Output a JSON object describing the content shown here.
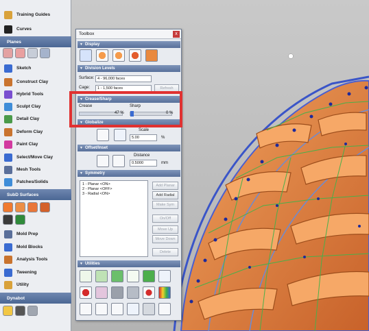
{
  "sidebar": {
    "items": [
      {
        "label": "Training Guides",
        "icon": "training-guides-icon",
        "color": "#d9a23b"
      },
      {
        "label": "Curves",
        "icon": "curves-icon",
        "color": "#222222"
      },
      {
        "label": "Sketch",
        "icon": "sketch-icon",
        "color": "#3a6bd1"
      },
      {
        "label": "Construct Clay",
        "icon": "construct-clay-icon",
        "color": "#c9742f"
      },
      {
        "label": "Hybrid Tools",
        "icon": "hybrid-tools-icon",
        "color": "#7a4fd0"
      },
      {
        "label": "Sculpt Clay",
        "icon": "sculpt-clay-icon",
        "color": "#3f8dd8"
      },
      {
        "label": "Detail Clay",
        "icon": "detail-clay-icon",
        "color": "#4a9a4a"
      },
      {
        "label": "Deform Clay",
        "icon": "deform-clay-icon",
        "color": "#c9742f"
      },
      {
        "label": "Paint Clay",
        "icon": "paint-clay-icon",
        "color": "#d23aa0"
      },
      {
        "label": "Select/Move Clay",
        "icon": "select-move-clay-icon",
        "color": "#3a6bd1"
      },
      {
        "label": "Mesh Tools",
        "icon": "mesh-tools-icon",
        "color": "#5a6f9a"
      },
      {
        "label": "Patches/Solids",
        "icon": "patches-solids-icon",
        "color": "#3f8dd8"
      },
      {
        "label": "Mold Prep",
        "icon": "mold-prep-icon",
        "color": "#5a6f9a"
      },
      {
        "label": "Mold Blocks",
        "icon": "mold-blocks-icon",
        "color": "#3a6bd1"
      },
      {
        "label": "Analysis Tools",
        "icon": "analysis-tools-icon",
        "color": "#c9742f"
      },
      {
        "label": "Tweening",
        "icon": "tweening-icon",
        "color": "#3a6bd1"
      },
      {
        "label": "Utility",
        "icon": "utility-icon",
        "color": "#d9a23b"
      }
    ],
    "headers": [
      "Planes",
      "SubD Surfaces",
      "Dynabot"
    ]
  },
  "toolbox": {
    "title": "Toolbox",
    "close": "x",
    "sections": {
      "display": "Display",
      "division_levels": "Division Levels",
      "crease_sharp": "Crease/Sharp",
      "globalize": "Globalize",
      "offset_inset": "Offset/Inset",
      "symmetry": "Symmetry",
      "utilities": "Utilities"
    },
    "division": {
      "surface_label": "Surface:",
      "surface_value": "4 - 96,000 faces",
      "cage_label": "Cage:",
      "cage_value": "1 - 1,500 faces",
      "button": "Refresh"
    },
    "crease": {
      "crease_label": "Crease",
      "sharp_label": "Sharp",
      "crease_value": "47 %",
      "sharp_value": "0 %"
    },
    "scale": {
      "label": "Scale",
      "value": "5.00",
      "unit": "%"
    },
    "offset": {
      "label": "Distance",
      "value": "0.5000",
      "unit": "mm"
    },
    "symmetry": {
      "list": [
        "1 - Planar <ON>",
        "2 - Planar <OFF>",
        "3 - Radial <ON>"
      ],
      "buttons": [
        "Add Planar",
        "Add Radial",
        "Make Sym",
        "On/Off",
        "Move Up",
        "Move Down",
        "Delete"
      ]
    }
  }
}
